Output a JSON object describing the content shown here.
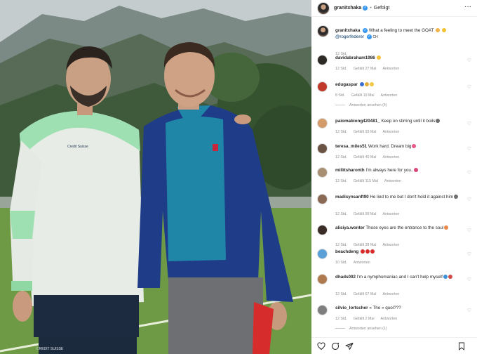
{
  "header": {
    "username": "granitxhaka",
    "separator": "•",
    "follow_label": "Gefolgt",
    "more": "···"
  },
  "caption": {
    "username": "granitxhaka",
    "text": "What a feeling to meet the GOAT",
    "mention": "@rogerfederer",
    "mention_suffix": "CH",
    "time": "12 Std."
  },
  "comments": [
    {
      "username": "davidabraham1986",
      "text": "",
      "time": "12 Std.",
      "likes": "Gefällt 27 Mal",
      "reply": "Antworten",
      "avatar_color": "#2d2a26",
      "emoji_colors": [
        "#f7c23b"
      ]
    },
    {
      "username": "edugaspar",
      "text": "",
      "time": "8 Std.",
      "likes": "Gefällt 19 Mal",
      "reply": "Antworten",
      "avatar_color": "#c0392b",
      "emoji_colors": [
        "#3b6fd1",
        "#e0b03a",
        "#f2c744"
      ],
      "view_replies": "Antworten ansehen (4)"
    },
    {
      "username": "paiomabiong420481_",
      "text": "Keep on stirring until it boils",
      "time": "12 Std.",
      "likes": "Gefällt 93 Mal",
      "reply": "Antworten",
      "avatar_color": "#d39a6a",
      "emoji_colors": [
        "#6f6f6f"
      ]
    },
    {
      "username": "teresa_miles51",
      "text": "Work hard. Dream big",
      "time": "12 Std.",
      "likes": "Gefällt 40 Mal",
      "reply": "Antworten",
      "avatar_color": "#6b5344",
      "emoji_colors": [
        "#e95a8c"
      ]
    },
    {
      "username": "millitsharonth",
      "text": "I'm always here for you..",
      "time": "12 Std.",
      "likes": "Gefällt 115 Mal",
      "reply": "Antworten",
      "avatar_color": "#a98f72",
      "emoji_colors": [
        "#d9477b"
      ]
    },
    {
      "username": "madisynsanft90",
      "text": "He lied to me but I don't hold it against him",
      "time": "12 Std.",
      "likes": "Gefällt 99 Mal",
      "reply": "Antworten",
      "avatar_color": "#8a6a55",
      "emoji_colors": [
        "#6f6f6f"
      ]
    },
    {
      "username": "alisiya.wonter",
      "text": "Those eyes are the entrance to the soul",
      "time": "12 Std.",
      "likes": "Gefällt 28 Mal",
      "reply": "Antworten",
      "avatar_color": "#3a2d28",
      "emoji_colors": [
        "#e8884a"
      ]
    },
    {
      "username": "beachdeng",
      "text": "",
      "time": "10 Std.",
      "likes": "",
      "reply": "Antworten",
      "avatar_color": "#5aa0d8",
      "emoji_colors": [
        "#d62b2b",
        "#d62b2b",
        "#d62b2b"
      ]
    },
    {
      "username": "dhads092",
      "text": "I'm a nymphomaniac and I can't help myself",
      "time": "12 Std.",
      "likes": "Gefällt 67 Mal",
      "reply": "Antworten",
      "avatar_color": "#b07a4f",
      "emoji_colors": [
        "#3c8fd9",
        "#cf4b4b"
      ]
    },
    {
      "username": "silvio_lortscher",
      "text": "« The » quoi???",
      "time": "12 Std.",
      "likes": "Gefällt 2 Mal",
      "reply": "Antworten",
      "avatar_color": "#7f7f7f",
      "emoji_colors": [],
      "view_replies": "Antworten ansehen (1)"
    }
  ],
  "photo": {
    "left_shirt_text": "Credit Suisse",
    "left_shorts_text": "CREDIT SUISSE"
  }
}
